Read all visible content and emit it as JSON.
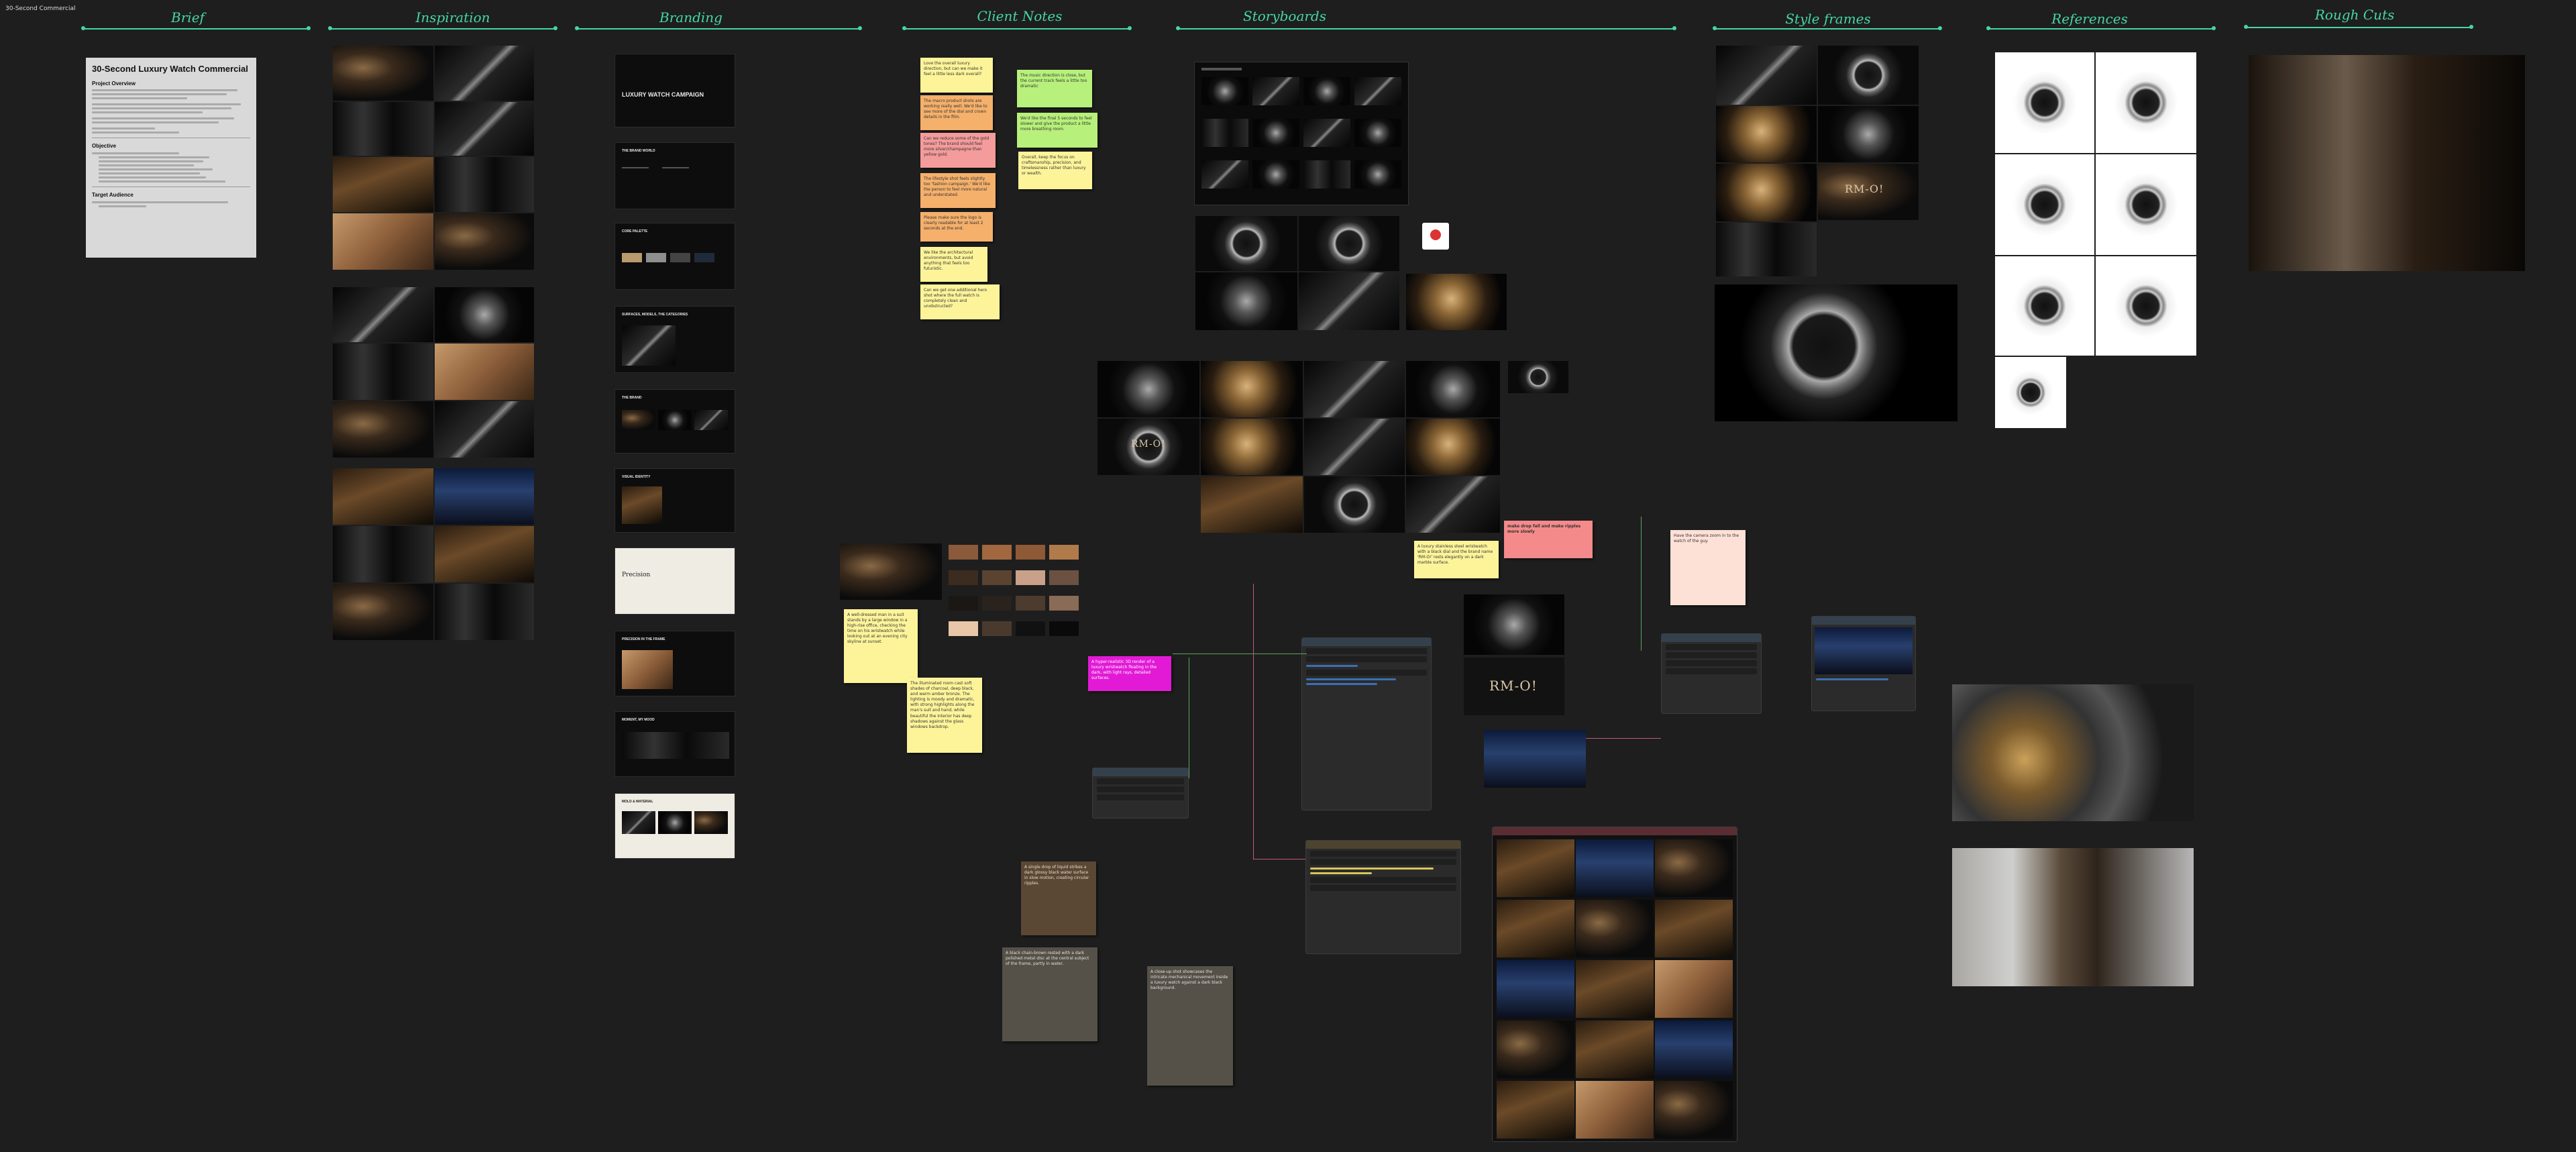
{
  "board": {
    "name": "30-Second Commercial"
  },
  "sections": {
    "brief": "Brief",
    "inspiration": "Inspiration",
    "branding": "Branding",
    "client_notes": "Client Notes",
    "storyboards": "Storyboards",
    "style_frames": "Style frames",
    "references": "References",
    "rough_cuts": "Rough Cuts"
  },
  "brief": {
    "title": "30-Second Luxury Watch Commercial",
    "overview_heading": "Project Overview",
    "objective_heading": "Objective",
    "audience_heading": "Target Audience"
  },
  "branding": {
    "card1_title": "LUXURY WATCH CAMPAIGN",
    "card2_title": "THE BRAND WORLD",
    "card3_title": "CORE PALETTE",
    "card4_title": "SURFACES, MODELS, THE CATEGORIES",
    "card5_title": "THE BRAND",
    "card6_title": "VISUAL IDENTITY",
    "card7_title": "Precision",
    "card8_title": "PRECISION IN THE FRAME",
    "card9_title": "MOMENT, MY MOOD",
    "card10_title": "MOLD & MATERIAL"
  },
  "client_notes": {
    "n1": "Love the overall luxury direction, but can we make it feel a little less dark overall?",
    "n2": "The music direction is close, but the current track feels a little too dramatic",
    "n3": "The macro product shots are working really well. We'd like to see more of the dial and crown details in the film.",
    "n4": "We'd like the final 5 seconds to feel slower and give the product a little more breathing room.",
    "n5": "Can we reduce some of the gold tones? The brand should feel more silver/champagne than yellow gold.",
    "n6": "Overall, keep the focus on craftsmanship, precision, and timelessness rather than luxury or wealth.",
    "n7": "The lifestyle shot feels slightly too 'fashion campaign.' We'd like the person to feel more natural and understated.",
    "n8": "Please make sure the logo is clearly readable for at least 2 seconds at the end.",
    "n9": "We like the architectural environments, but avoid anything that feels too futuristic.",
    "n10": "Can we get one additional hero shot where the full watch is completely clean and unobstructed?"
  },
  "notes": {
    "swatch_note": "A well-dressed man in a suit stands by a large window in a high-rise office, checking the time on his wristwatch while looking out at an evening city skyline at sunset.",
    "scene_note": "The illuminated room cast soft shades of charcoal, deep black, and warm amber bronze. The lighting is moody and dramatic, with strong highlights along the man's suit and hand, while beautiful the interior has deep shadows against the glass windows backdrop.",
    "magenta_note": "A hyper-realistic 3D render of a luxury wristwatch floating in the dark, with light rays, detailed surfaces.",
    "salmon_note": "make drop fall and make ripples more slowly",
    "luxury_note": "A luxury stainless steel wristwatch with a black dial and the brand name 'RM-O!' rests elegantly on a dark marble surface.",
    "peach_note": "Have the camera zoom in to the watch of the guy.",
    "brown_note": "A single drop of liquid strikes a dark glossy black water surface in slow motion, creating circular ripples.",
    "gray1_note": "A black chain-brown rested with a dark polished metal disc at the central subject of the frame, partly in water.",
    "gray2_note": "A close-up shot showcases the intricate mechanical movement inside a luxury watch against a dark black background."
  },
  "logo": {
    "text": "RM-O!"
  },
  "icons": {
    "image_badge": "image-badge-icon"
  },
  "colors": {
    "accent": "#46d6a6",
    "canvas": "#1e1e1e"
  }
}
